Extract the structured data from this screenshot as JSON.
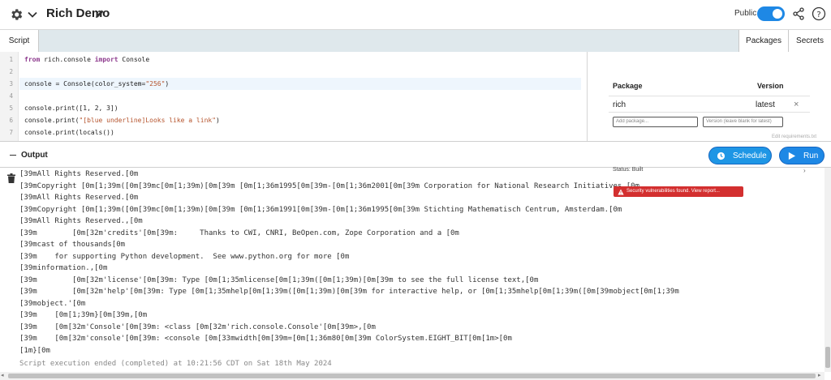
{
  "header": {
    "title": "Rich Demo",
    "public_label": "Public",
    "public_on": true,
    "icons": [
      "gear-icon",
      "chevron-down-icon",
      "pencil-icon",
      "share-icon",
      "help-icon"
    ]
  },
  "tabs": {
    "script": "Script",
    "packages": "Packages",
    "secrets": "Secrets"
  },
  "editor": {
    "lines": [
      {
        "num": "1",
        "code": "from rich.console import Console"
      },
      {
        "num": "2",
        "code": ""
      },
      {
        "num": "3",
        "code": "console = Console(color_system=\"256\")"
      },
      {
        "num": "4",
        "code": ""
      },
      {
        "num": "5",
        "code": "console.print([1, 2, 3])"
      },
      {
        "num": "6",
        "code": "console.print(\"[blue underline]Looks like a link\")"
      },
      {
        "num": "7",
        "code": "console.print(locals())"
      }
    ],
    "active_line": "3"
  },
  "packages": {
    "col_package": "Package",
    "col_version": "Version",
    "rows": [
      {
        "name": "rich",
        "version": "latest"
      }
    ],
    "remove_glyph": "×",
    "add_placeholder": "Add package...",
    "version_placeholder": "Version (leave blank for latest)",
    "note": "Edit requirements.txt"
  },
  "output": {
    "label": "Output",
    "schedule_label": "Schedule",
    "run_label": "Run",
    "status_text": "Status: Built",
    "alert_text": "Security vulnerabilities found. View report...",
    "lines": [
      "\u001b[39mAll Rights Reserved.\u001b[0m",
      "\u001b[39mCopyright \u001b[0m\u001b[1;39m(\u001b[0m\u001b[39mc\u001b[0m\u001b[1;39m)\u001b[0m\u001b[39m \u001b[0m\u001b[1;36m1995\u001b[0m\u001b[39m-\u001b[0m\u001b[1;36m2001\u001b[0m\u001b[39m Corporation for National Research Initiatives.\u001b[0m",
      "\u001b[39mAll Rights Reserved.\u001b[0m",
      "\u001b[39mCopyright \u001b[0m\u001b[1;39m(\u001b[0m\u001b[39mc\u001b[0m\u001b[1;39m)\u001b[0m\u001b[39m \u001b[0m\u001b[1;36m1991\u001b[0m\u001b[39m-\u001b[0m\u001b[1;36m1995\u001b[0m\u001b[39m Stichting Mathematisch Centrum, Amsterdam.\u001b[0m",
      "\u001b[39mAll Rights Reserved.,\u001b[0m",
      "\u001b[39m        \u001b[0m\u001b[32m'credits'\u001b[0m\u001b[39m:     Thanks to CWI, CNRI, BeOpen.com, Zope Corporation and a \u001b[0m",
      "\u001b[39mcast of thousands\u001b[0m",
      "\u001b[39m    for supporting Python development.  See www.python.org for more \u001b[0m",
      "\u001b[39minformation.,\u001b[0m",
      "\u001b[39m        \u001b[0m\u001b[32m'license'\u001b[0m\u001b[39m: Type \u001b[0m\u001b[1;35mlicense\u001b[0m\u001b[1;39m(\u001b[0m\u001b[1;39m)\u001b[0m\u001b[39m to see the full license text,\u001b[0m",
      "\u001b[39m        \u001b[0m\u001b[32m'help'\u001b[0m\u001b[39m: Type \u001b[0m\u001b[1;35mhelp\u001b[0m\u001b[1;39m(\u001b[0m\u001b[1;39m)\u001b[0m\u001b[39m for interactive help, or \u001b[0m\u001b[1;35mhelp\u001b[0m\u001b[1;39m(\u001b[0m\u001b[39mobject\u001b[0m\u001b[1;39m",
      "\u001b[39mobject.'\u001b[0m",
      "\u001b[39m    \u001b[0m\u001b[1;39m}\u001b[0m\u001b[39m,\u001b[0m",
      "\u001b[39m    \u001b[0m\u001b[32m'Console'\u001b[0m\u001b[39m: <class \u001b[0m\u001b[32m'rich.console.Console'\u001b[0m\u001b[39m>,\u001b[0m",
      "\u001b[39m    \u001b[0m\u001b[32m'console'\u001b[0m\u001b[39m: <console \u001b[0m\u001b[33mwidth\u001b[0m\u001b[39m=\u001b[0m\u001b[1;36m80\u001b[0m\u001b[39m ColorSystem.EIGHT_BIT\u001b[0m\u001b[1m>\u001b[0m",
      "\u001b[1m}\u001b[0m"
    ],
    "completion": "Script execution ended (completed) at 10:21:56 CDT on Sat 18th May 2024"
  }
}
